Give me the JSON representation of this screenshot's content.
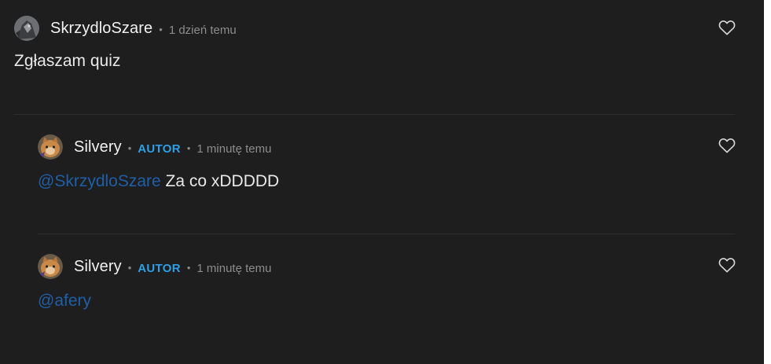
{
  "colors": {
    "background": "#1e1e1e",
    "username": "#f2f2f2",
    "author_badge": "#2f9fe6",
    "mention": "#1f5fa8",
    "timestamp": "#8c8c8c",
    "divider": "#2d2d2d"
  },
  "separator": "•",
  "comments": [
    {
      "username": "SkrzydloSzare",
      "timestamp": "1 dzień temu",
      "body": "Zgłaszam quiz",
      "like_icon": "heart-outline-icon"
    }
  ],
  "replies": [
    {
      "username": "Silvery",
      "badge": "AUTOR",
      "timestamp": "1 minutę temu",
      "mention": "@SkrzydloSzare",
      "body": " Za co xDDDDD",
      "like_icon": "heart-outline-icon"
    },
    {
      "username": "Silvery",
      "badge": "AUTOR",
      "timestamp": "1 minutę temu",
      "mention": "@afery",
      "body": "",
      "like_icon": "heart-outline-icon"
    }
  ]
}
